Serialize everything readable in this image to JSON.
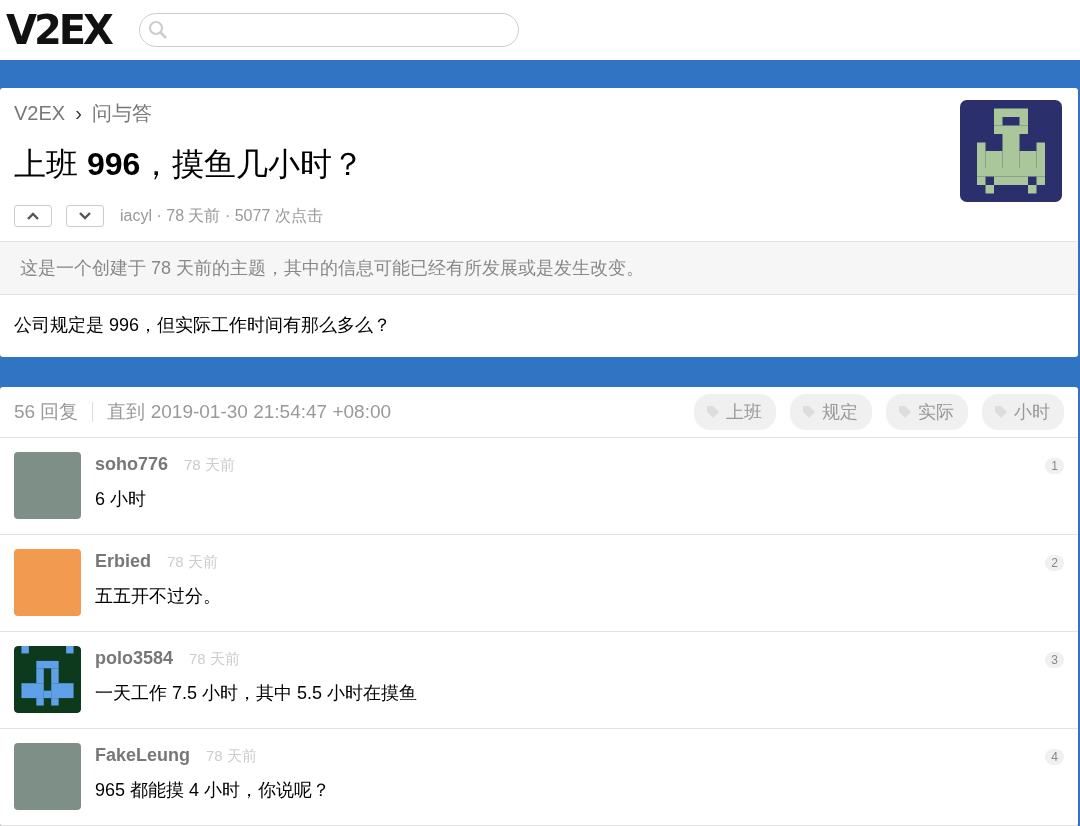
{
  "header": {
    "logo": "V2EX"
  },
  "topic": {
    "breadcrumb": [
      "V2EX",
      "问与答"
    ],
    "separator": "›",
    "title": "上班 **996**，摸鱼几小时？",
    "meta": "iacyl · 78 天前 · 5077 次点击",
    "notice": "这是一个创建于 78 天前的主题，其中的信息可能已经有所发展或是发生改变。",
    "content": "公司规定是 996，但实际工作时间有那么多么？"
  },
  "replies_header": {
    "count": "56 回复",
    "until": "直到 2019-01-30 21:54:47 +08:00",
    "tags": [
      "上班",
      "规定",
      "实际",
      "小时"
    ]
  },
  "replies": [
    {
      "user": "soho776",
      "time": "78 天前",
      "text": "6 小时",
      "floor": "1",
      "kind": "photo"
    },
    {
      "user": "Erbied",
      "time": "78 天前",
      "text": "五五开不过分。",
      "floor": "2",
      "kind": "drawing"
    },
    {
      "user": "polo3584",
      "time": "78 天前",
      "text": "一天工作 7.5 小时，其中 5.5 小时在摸鱼",
      "floor": "3",
      "kind": "pixel"
    },
    {
      "user": "FakeLeung",
      "time": "78 天前",
      "text": "965 都能摸 4 小时，你说呢？",
      "floor": "4",
      "kind": "photo"
    }
  ]
}
